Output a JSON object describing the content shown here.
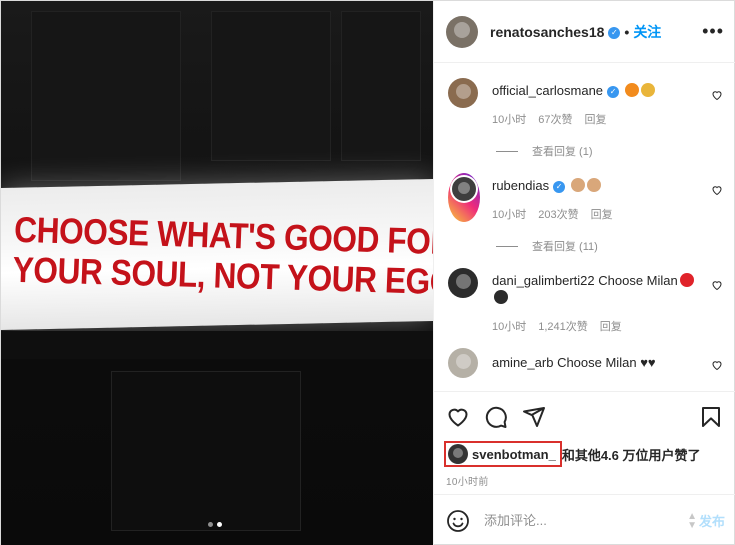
{
  "media": {
    "sign_line1": "CHOOSE WHAT'S GOOD FOR",
    "sign_line2": "YOUR SOUL, NOT YOUR EGO",
    "carousel_total": 2,
    "carousel_active": 2
  },
  "header": {
    "username": "renatosanches18",
    "separator": "•",
    "follow_label": "关注",
    "more_icon": "more-horizontal-icon"
  },
  "comments": [
    {
      "username": "official_carlosmane",
      "verified": true,
      "text": "",
      "emoji": [
        "fire-emoji",
        "raised-hands-emoji"
      ],
      "time": "10小时",
      "likes": "67次赞",
      "reply": "回复",
      "view_replies": "查看回复 (1)"
    },
    {
      "username": "rubendias",
      "verified": true,
      "text": "",
      "emoji": [
        "clap-emoji",
        "clap-emoji"
      ],
      "time": "10小时",
      "likes": "203次赞",
      "reply": "回复",
      "view_replies": "查看回复 (11)"
    },
    {
      "username": "dani_galimberti22",
      "verified": false,
      "text": "Choose Milan",
      "emoji": [
        "red-circle-emoji",
        "black-circle-emoji"
      ],
      "time": "10小时",
      "likes": "1,241次赞",
      "reply": "回复",
      "view_replies": ""
    },
    {
      "username": "amine_arb",
      "verified": false,
      "text": "Choose Milan",
      "emoji": [
        "black-heart-emoji",
        "black-heart-emoji"
      ],
      "time": "",
      "likes": "",
      "reply": "",
      "view_replies": ""
    }
  ],
  "actions": {
    "liker_username": "svenbotman_",
    "likes_suffix": "和其他4.6 万位用户赞了",
    "timestamp": "10小时前"
  },
  "add_comment": {
    "placeholder": "添加评论...",
    "post_label": "发布"
  },
  "colors": {
    "accent": "#0095f6",
    "highlight_box": "#d9302c",
    "sign_text": "#c4121a",
    "post_disabled": "#b2dffc"
  }
}
